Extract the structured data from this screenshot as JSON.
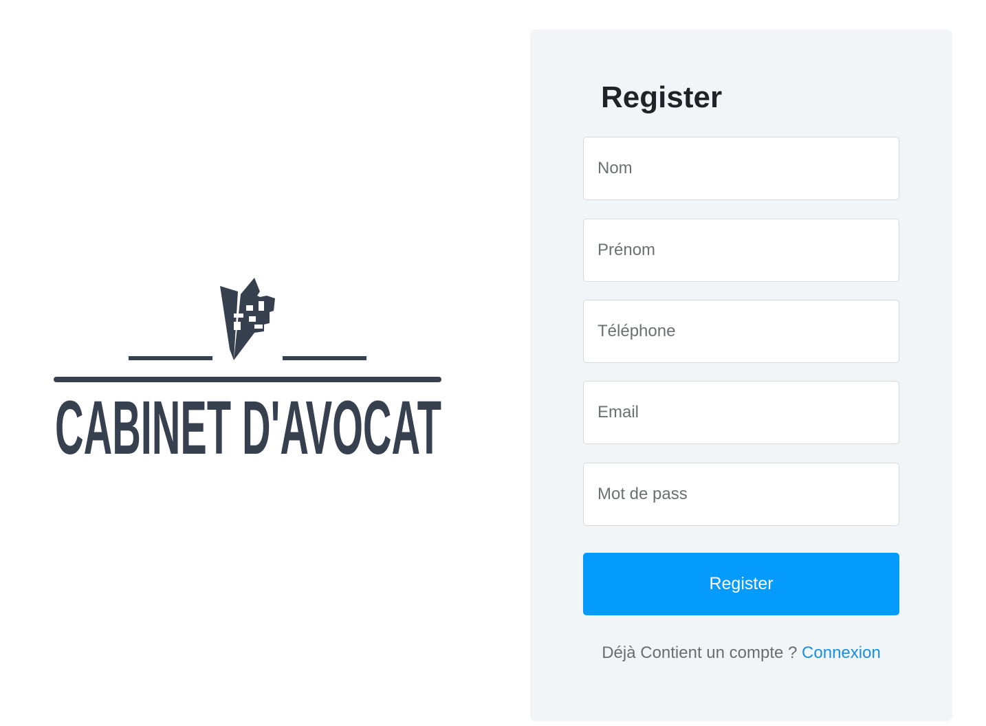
{
  "brand": {
    "logo_text": "CABINET D'AVOCAT",
    "color": "#36404f"
  },
  "form": {
    "title": "Register",
    "fields": [
      {
        "placeholder": "Nom",
        "value": ""
      },
      {
        "placeholder": "Prénom",
        "value": ""
      },
      {
        "placeholder": "Téléphone",
        "value": ""
      },
      {
        "placeholder": "Email",
        "value": ""
      },
      {
        "placeholder": "Mot de pass",
        "value": ""
      }
    ],
    "submit_label": "Register",
    "footer_text": "Déjà Contient un compte ?",
    "footer_link": "Connexion"
  },
  "colors": {
    "panel_bg": "#f1f5f8",
    "accent": "#049bfd",
    "link": "#1a8fe0"
  },
  "icons": {
    "logo_mark": "book-pen-emblem-icon"
  }
}
